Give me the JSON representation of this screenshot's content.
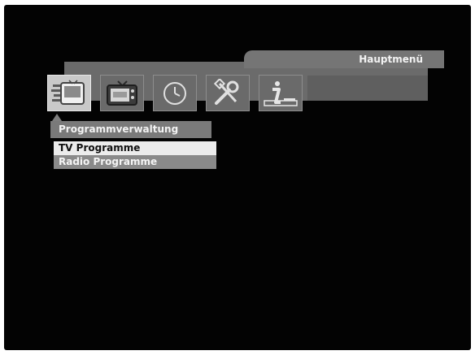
{
  "window": {
    "title": "Hauptmenü"
  },
  "toolbar": {
    "icons": [
      {
        "name": "channel-management-icon",
        "selected": true
      },
      {
        "name": "tv-icon",
        "selected": false
      },
      {
        "name": "clock-icon",
        "selected": false
      },
      {
        "name": "tools-icon",
        "selected": false
      },
      {
        "name": "info-icon",
        "selected": false
      }
    ]
  },
  "menu": {
    "title": "Programmverwaltung",
    "items": [
      {
        "label": "TV Programme",
        "active": true
      },
      {
        "label": "Radio Programme",
        "active": false
      }
    ]
  },
  "colors": {
    "screen_background": "#030303",
    "highlight": "#ececec",
    "panel_gray": "#7a7a7a"
  }
}
